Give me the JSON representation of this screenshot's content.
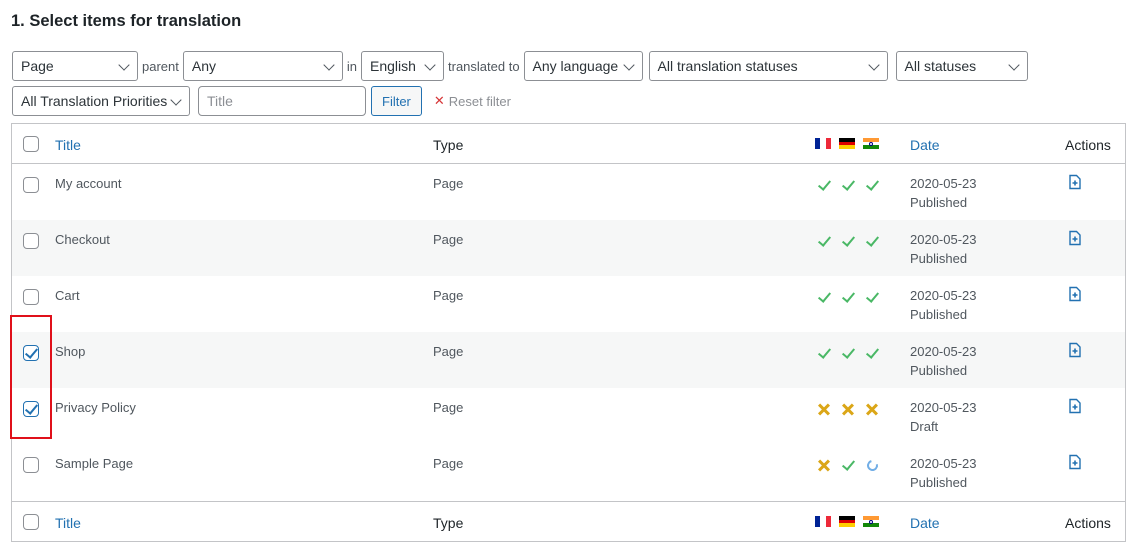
{
  "heading": "1. Select items for translation",
  "filters": {
    "post_type": "Page",
    "parent_label": "parent",
    "parent": "Any",
    "in_label": "in",
    "language": "English",
    "translated_to_label": "translated to",
    "target_language": "Any language",
    "translation_status": "All translation statuses",
    "status": "All statuses",
    "priority": "All Translation Priorities",
    "title_placeholder": "Title",
    "filter_button": "Filter",
    "reset_label": "Reset filter"
  },
  "columns": {
    "title": "Title",
    "type": "Type",
    "date": "Date",
    "actions": "Actions",
    "flags": [
      "fr",
      "de",
      "in"
    ]
  },
  "rows": [
    {
      "title": "My account",
      "type": "Page",
      "date": "2020-05-23",
      "status": "Published",
      "checked": false,
      "langs": [
        "ok",
        "ok",
        "ok"
      ]
    },
    {
      "title": "Checkout",
      "type": "Page",
      "date": "2020-05-23",
      "status": "Published",
      "checked": false,
      "langs": [
        "ok",
        "ok",
        "ok"
      ]
    },
    {
      "title": "Cart",
      "type": "Page",
      "date": "2020-05-23",
      "status": "Published",
      "checked": false,
      "langs": [
        "ok",
        "ok",
        "ok"
      ]
    },
    {
      "title": "Shop",
      "type": "Page",
      "date": "2020-05-23",
      "status": "Published",
      "checked": true,
      "langs": [
        "ok",
        "ok",
        "ok"
      ]
    },
    {
      "title": "Privacy Policy",
      "type": "Page",
      "date": "2020-05-23",
      "status": "Draft",
      "checked": true,
      "langs": [
        "no",
        "no",
        "no"
      ]
    },
    {
      "title": "Sample Page",
      "type": "Page",
      "date": "2020-05-23",
      "status": "Published",
      "checked": false,
      "langs": [
        "no",
        "ok",
        "sync"
      ]
    }
  ],
  "colors": {
    "accent": "#2271b1",
    "ok": "#4ab866",
    "missing": "#dba617",
    "highlight": "#e0101a"
  }
}
